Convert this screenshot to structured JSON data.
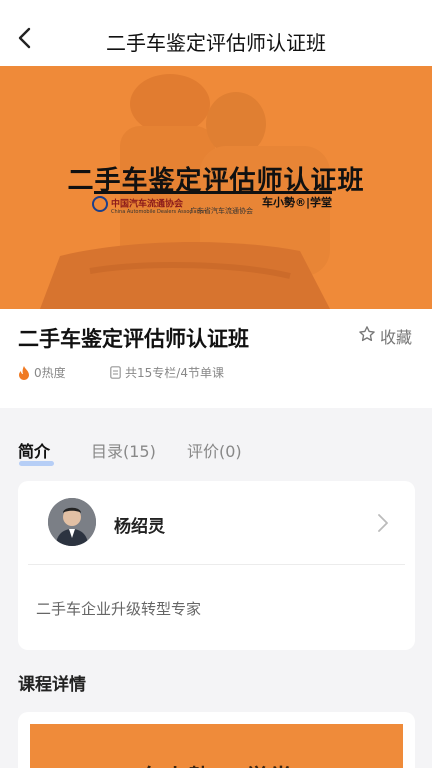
{
  "nav": {
    "title": "二手车鉴定评估师认证班",
    "back_icon": "back-arrow-icon"
  },
  "banner": {
    "title": "二手车鉴定评估师认证班",
    "logo_left": "中国汽车流通协会",
    "logo_left_sub": "China Automobile Dealers Association",
    "logo_mid": "广东省汽车流通协会",
    "logo_right": "车小勢®|学堂",
    "bg_color": "#ef8b3a"
  },
  "course": {
    "title": "二手车鉴定评估师认证班",
    "favorite_label": "收藏",
    "hot": "0热度",
    "count": "共15专栏/4节单课"
  },
  "tabs": [
    {
      "label": "简介",
      "active": true
    },
    {
      "label": "目录(15)",
      "active": false
    },
    {
      "label": "评价(0)",
      "active": false
    }
  ],
  "teacher": {
    "name": "杨绍灵",
    "desc": "二手车企业升级转型专家"
  },
  "details": {
    "title": "课程详情",
    "preview_text": "车小勢®|学堂"
  }
}
